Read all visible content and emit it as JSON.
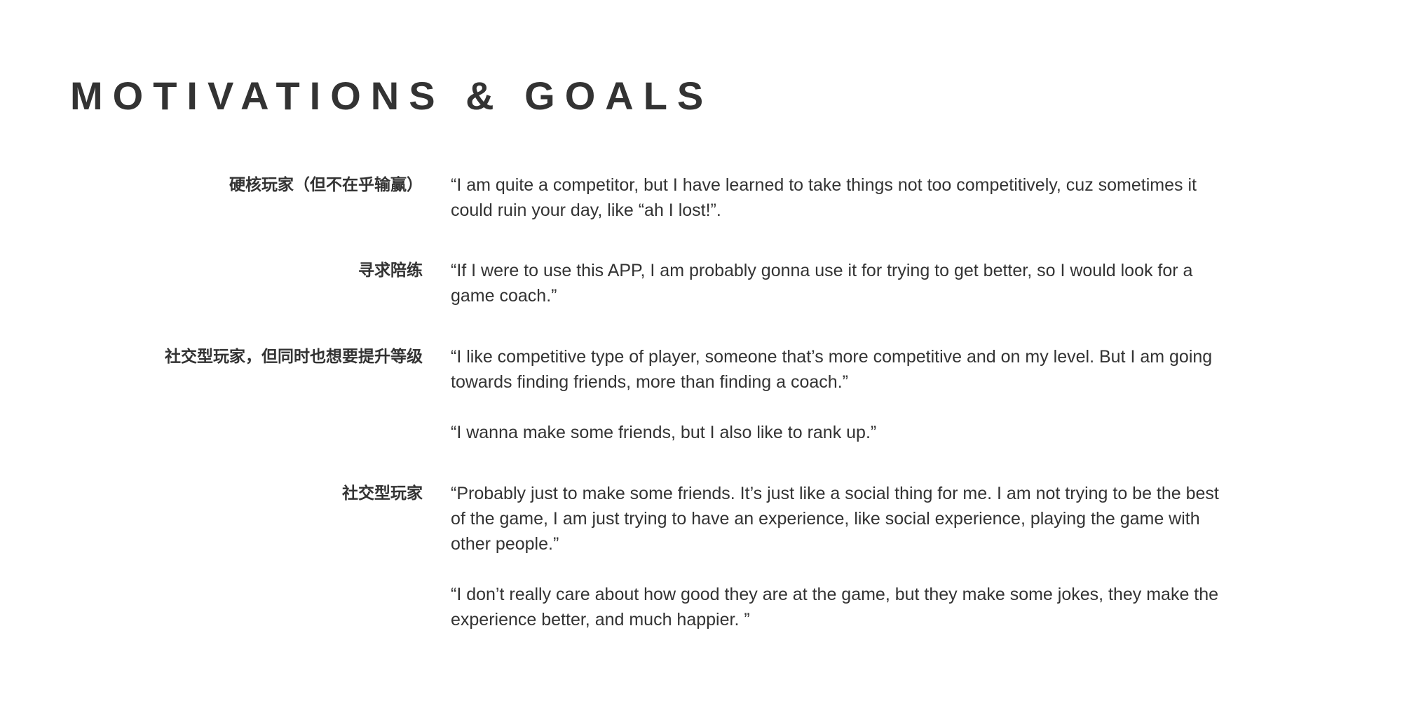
{
  "page": {
    "title": "MOTIVATIONS & GOALS"
  },
  "sections": [
    {
      "label": "硬核玩家（但不在乎输赢）",
      "quotes": [
        "“I am quite a competitor, but I have learned to take things not too competitively, cuz sometimes it could ruin your day, like “ah I lost!”."
      ]
    },
    {
      "label": "寻求陪练",
      "quotes": [
        "“If I were to use this APP, I am probably gonna use it for trying to get better, so I would look for a game coach.”"
      ]
    },
    {
      "label": "社交型玩家，但同时也想要提升等级",
      "quotes": [
        "“I like competitive type of player, someone that’s more competitive and on my level. But I am going towards finding friends, more than finding a coach.”",
        "“I wanna make some friends, but I also like to rank up.”"
      ]
    },
    {
      "label": "社交型玩家",
      "quotes": [
        "“Probably just to make some friends. It’s just like a social thing for me. I am not trying to be the best of the game, I am just trying to have an experience, like social experience, playing the game with other people.”",
        "“I don’t really care about how good they are at the game, but they make some jokes, they make the experience better, and much happier. ”"
      ]
    }
  ],
  "colors": {
    "text": "#333333",
    "background": "#ffffff"
  }
}
